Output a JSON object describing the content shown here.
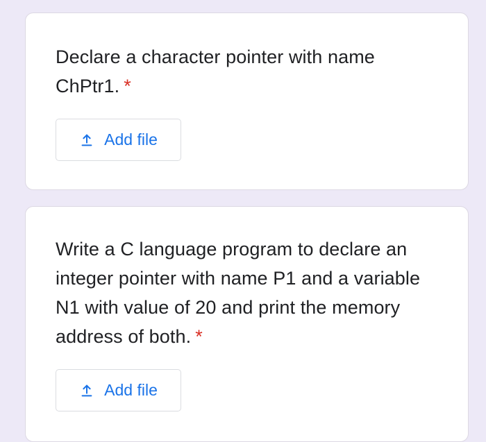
{
  "questions": [
    {
      "text": "Declare a character pointer with name ChPtr1.",
      "required_mark": "*",
      "button_label": "Add file",
      "button_icon": "upload-icon"
    },
    {
      "text": "Write a C language program to declare an integer pointer with name P1 and a variable N1 with value of 20 and print the memory address of both.",
      "required_mark": "*",
      "button_label": "Add file",
      "button_icon": "upload-icon"
    }
  ],
  "colors": {
    "page_background": "#ede9f7",
    "card_background": "#ffffff",
    "question_text": "#202124",
    "required_mark": "#d93025",
    "button_text": "#1a73e8",
    "button_border": "#dadce0"
  }
}
